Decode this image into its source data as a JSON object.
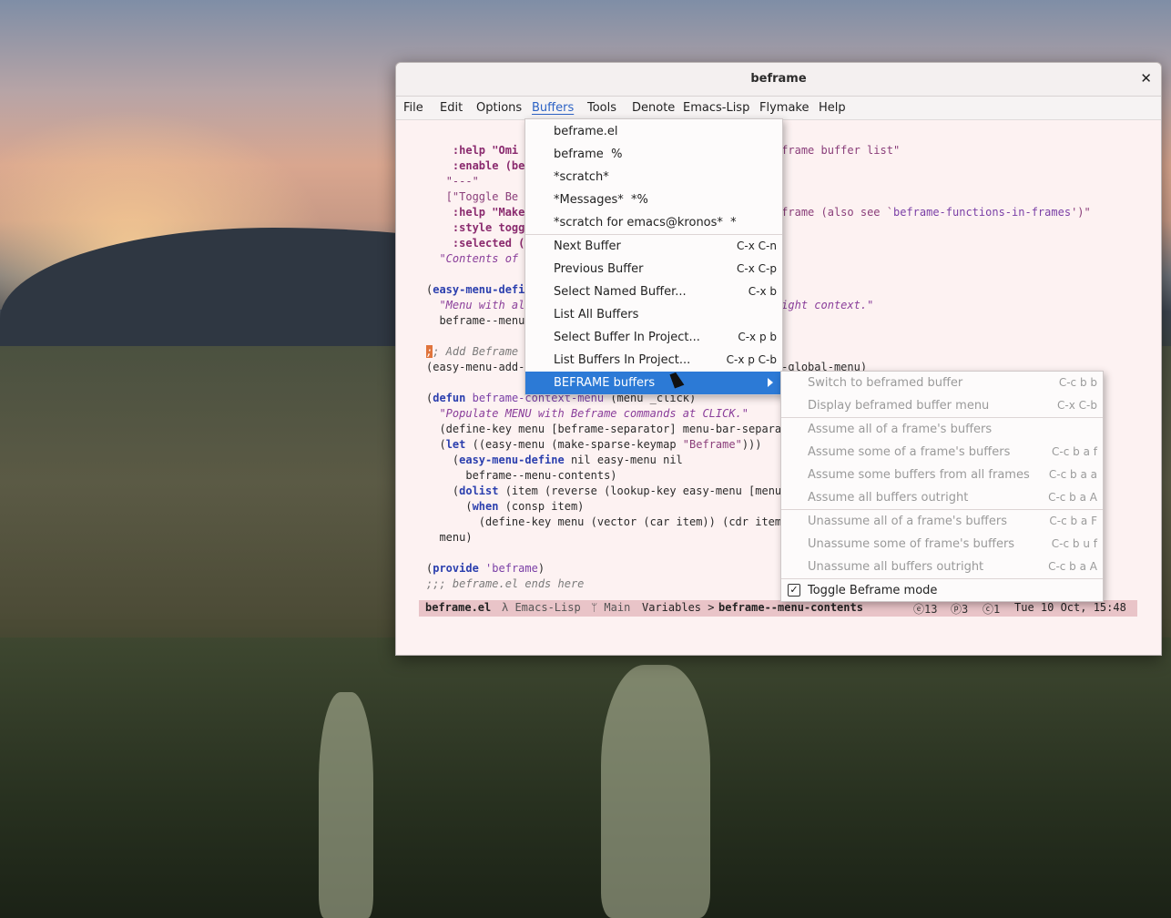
{
  "window": {
    "title": "beframe"
  },
  "menubar": [
    "File",
    "Edit",
    "Options",
    "Buffers",
    "Tools",
    "Denote",
    "Emacs-Lisp",
    "Flymake",
    "Help"
  ],
  "code": {
    "l1_a": ":help \"Omi",
    "l1_b": "frame buffer list\"",
    "l2_a": ":enable (be",
    "l3": "\"---\"",
    "l4": "[\"Toggle Be",
    "l5_a": ":help \"Make",
    "l5_b": "frame (also see `",
    "l5_c": "beframe-functions-in-frames",
    "l5_d": "')\"",
    "l6": ":style togg",
    "l7": ":selected (",
    "l8": "\"Contents of t",
    "l10_kw": "easy-menu-defi",
    "l11_a": "\"Menu with al",
    "l11_b": "right context.\"",
    "l12": "beframe--menu-",
    "l14_c": ";",
    "l14_t": "; Add Beframe m",
    "l15_a": "(easy-menu-add-",
    "l15_b": "rame-global-menu)",
    "l17_kw": "defun",
    "l17_fn": "beframe-context-menu",
    "l17_args": " (menu _click)",
    "l18": "\"Populate MENU with Beframe commands at CLICK.\"",
    "l19": "(define-key menu [beframe-separator] menu-bar-separato",
    "l20_kw": "let",
    "l20_a": " ((easy-menu (make-sparse-keymap ",
    "l20_s": "\"Beframe\"",
    "l20_b": ")))",
    "l21_kw": "easy-menu-define",
    "l21_b": " nil easy-menu nil",
    "l22": "beframe--menu-contents)",
    "l23_kw": "dolist",
    "l23_b": " (item (reverse (lookup-key easy-menu [menu-b",
    "l24_kw": "when",
    "l24_b": " (consp item)",
    "l25": "(define-key menu (vector (car item)) (cdr item))",
    "l26": "menu)",
    "l28_kw": "provide",
    "l28_s": "'beframe",
    "l29": ";;; beframe.el ends here"
  },
  "modeline": {
    "buffer": "beframe.el",
    "mode": "λ Emacs-Lisp",
    "branch": "ᛘ Main",
    "breadcrumb": "Variables > ",
    "breadcrumb_sym": "beframe--menu-contents",
    "stat1": "ⓔ13",
    "stat2": "ⓟ3",
    "stat3": "ⓒ1",
    "datetime": "Tue 10 Oct, 15:48"
  },
  "buffers_menu": [
    {
      "label": "beframe.el",
      "key": ""
    },
    {
      "label": "beframe  %",
      "key": ""
    },
    {
      "label": "*scratch*",
      "key": ""
    },
    {
      "label": "*Messages*  *%",
      "key": ""
    },
    {
      "label": "*scratch for emacs@kronos*  *",
      "key": ""
    },
    {
      "label": "Next Buffer",
      "key": "C-x C-n"
    },
    {
      "label": "Previous Buffer",
      "key": "C-x C-p"
    },
    {
      "label": "Select Named Buffer...",
      "key": "C-x b"
    },
    {
      "label": "List All Buffers",
      "key": ""
    },
    {
      "label": "Select Buffer In Project...",
      "key": "C-x p b"
    },
    {
      "label": "List Buffers In Project...",
      "key": "C-x p C-b"
    },
    {
      "label": "BEFRAME buffers",
      "key": ""
    }
  ],
  "beframe_submenu": [
    {
      "label": "Switch to beframed buffer",
      "key": "C-c b b"
    },
    {
      "label": "Display beframed buffer menu",
      "key": "C-x C-b"
    },
    {
      "label": "Assume all of a frame's buffers",
      "key": ""
    },
    {
      "label": "Assume some of a frame's buffers",
      "key": "C-c b a f"
    },
    {
      "label": "Assume some buffers from all frames",
      "key": "C-c b a a"
    },
    {
      "label": "Assume all buffers outright",
      "key": "C-c b a A"
    },
    {
      "label": "Unassume all of a frame's buffers",
      "key": "C-c b a F"
    },
    {
      "label": "Unassume some of frame's buffers",
      "key": "C-c b u f"
    },
    {
      "label": "Unassume all buffers outright",
      "key": "C-c b a A"
    },
    {
      "label": "Toggle Beframe mode",
      "key": ""
    }
  ],
  "icons": {
    "close": "close-icon",
    "checkbox": "check-icon",
    "submenu": "chevron-right-icon"
  }
}
